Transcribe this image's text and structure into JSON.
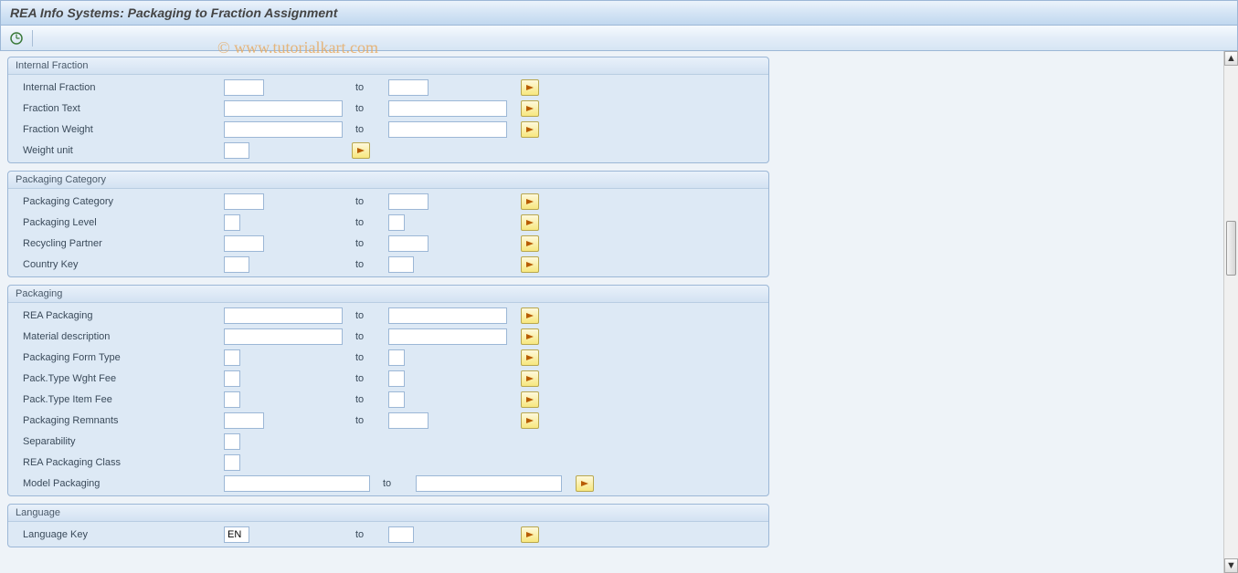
{
  "title": "REA Info Systems: Packaging to Fraction Assignment",
  "watermark": "© www.tutorialkart.com",
  "to_label": "to",
  "groups": {
    "internal_fraction": {
      "title": "Internal Fraction",
      "rows": {
        "internal_fraction": {
          "label": "Internal Fraction",
          "from": "",
          "to": ""
        },
        "fraction_text": {
          "label": "Fraction Text",
          "from": "",
          "to": ""
        },
        "fraction_weight": {
          "label": "Fraction Weight",
          "from": "",
          "to": ""
        },
        "weight_unit": {
          "label": "Weight unit",
          "from": ""
        }
      }
    },
    "packaging_category": {
      "title": "Packaging Category",
      "rows": {
        "packaging_category": {
          "label": "Packaging Category",
          "from": "",
          "to": ""
        },
        "packaging_level": {
          "label": "Packaging Level",
          "from": "",
          "to": ""
        },
        "recycling_partner": {
          "label": "Recycling Partner",
          "from": "",
          "to": ""
        },
        "country_key": {
          "label": "Country Key",
          "from": "",
          "to": ""
        }
      }
    },
    "packaging": {
      "title": "Packaging",
      "rows": {
        "rea_packaging": {
          "label": "REA Packaging",
          "from": "",
          "to": ""
        },
        "material_description": {
          "label": "Material description",
          "from": "",
          "to": ""
        },
        "packaging_form_type": {
          "label": "Packaging Form Type",
          "from": "",
          "to": ""
        },
        "pack_type_wght_fee": {
          "label": "Pack.Type Wght Fee",
          "from": "",
          "to": ""
        },
        "pack_type_item_fee": {
          "label": "Pack.Type Item Fee",
          "from": "",
          "to": ""
        },
        "packaging_remnants": {
          "label": "Packaging Remnants",
          "from": "",
          "to": ""
        },
        "separability": {
          "label": "Separability",
          "from": ""
        },
        "rea_packaging_class": {
          "label": "REA Packaging Class",
          "from": ""
        },
        "model_packaging": {
          "label": "Model Packaging",
          "from": "",
          "to": ""
        }
      }
    },
    "language": {
      "title": "Language",
      "rows": {
        "language_key": {
          "label": "Language Key",
          "from": "EN",
          "to": ""
        }
      }
    }
  }
}
